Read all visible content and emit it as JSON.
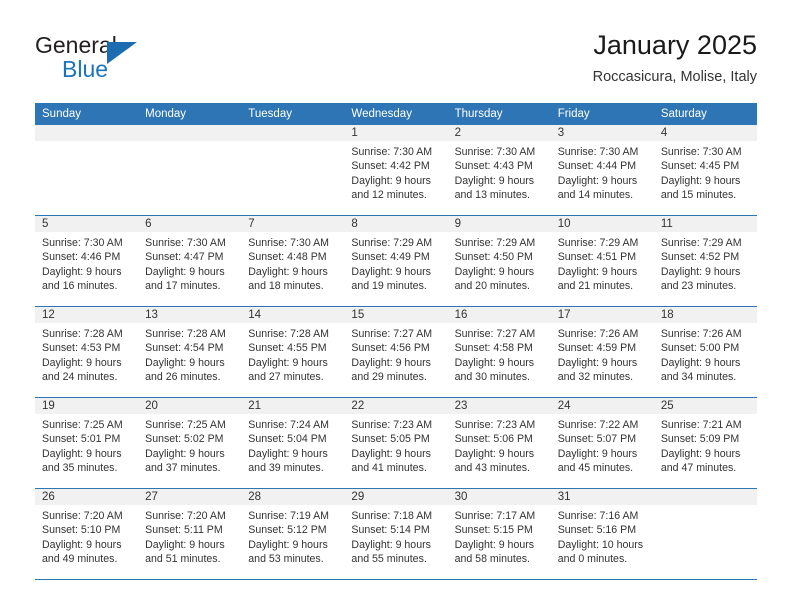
{
  "brand": {
    "name_part1": "General",
    "name_part2": "Blue",
    "logo_icon": "triangle-logo-icon"
  },
  "header": {
    "title": "January 2025",
    "subtitle": "Roccasicura, Molise, Italy"
  },
  "colors": {
    "header_blue": "#2e75b6",
    "brand_blue": "#1b75bb",
    "daynum_band": "#f1f1f1",
    "text": "#333333"
  },
  "calendar": {
    "weekday_headers": [
      "Sunday",
      "Monday",
      "Tuesday",
      "Wednesday",
      "Thursday",
      "Friday",
      "Saturday"
    ],
    "weeks": [
      [
        {
          "day": "",
          "lines": []
        },
        {
          "day": "",
          "lines": []
        },
        {
          "day": "",
          "lines": []
        },
        {
          "day": "1",
          "lines": [
            "Sunrise: 7:30 AM",
            "Sunset: 4:42 PM",
            "Daylight: 9 hours",
            "and 12 minutes."
          ]
        },
        {
          "day": "2",
          "lines": [
            "Sunrise: 7:30 AM",
            "Sunset: 4:43 PM",
            "Daylight: 9 hours",
            "and 13 minutes."
          ]
        },
        {
          "day": "3",
          "lines": [
            "Sunrise: 7:30 AM",
            "Sunset: 4:44 PM",
            "Daylight: 9 hours",
            "and 14 minutes."
          ]
        },
        {
          "day": "4",
          "lines": [
            "Sunrise: 7:30 AM",
            "Sunset: 4:45 PM",
            "Daylight: 9 hours",
            "and 15 minutes."
          ]
        }
      ],
      [
        {
          "day": "5",
          "lines": [
            "Sunrise: 7:30 AM",
            "Sunset: 4:46 PM",
            "Daylight: 9 hours",
            "and 16 minutes."
          ]
        },
        {
          "day": "6",
          "lines": [
            "Sunrise: 7:30 AM",
            "Sunset: 4:47 PM",
            "Daylight: 9 hours",
            "and 17 minutes."
          ]
        },
        {
          "day": "7",
          "lines": [
            "Sunrise: 7:30 AM",
            "Sunset: 4:48 PM",
            "Daylight: 9 hours",
            "and 18 minutes."
          ]
        },
        {
          "day": "8",
          "lines": [
            "Sunrise: 7:29 AM",
            "Sunset: 4:49 PM",
            "Daylight: 9 hours",
            "and 19 minutes."
          ]
        },
        {
          "day": "9",
          "lines": [
            "Sunrise: 7:29 AM",
            "Sunset: 4:50 PM",
            "Daylight: 9 hours",
            "and 20 minutes."
          ]
        },
        {
          "day": "10",
          "lines": [
            "Sunrise: 7:29 AM",
            "Sunset: 4:51 PM",
            "Daylight: 9 hours",
            "and 21 minutes."
          ]
        },
        {
          "day": "11",
          "lines": [
            "Sunrise: 7:29 AM",
            "Sunset: 4:52 PM",
            "Daylight: 9 hours",
            "and 23 minutes."
          ]
        }
      ],
      [
        {
          "day": "12",
          "lines": [
            "Sunrise: 7:28 AM",
            "Sunset: 4:53 PM",
            "Daylight: 9 hours",
            "and 24 minutes."
          ]
        },
        {
          "day": "13",
          "lines": [
            "Sunrise: 7:28 AM",
            "Sunset: 4:54 PM",
            "Daylight: 9 hours",
            "and 26 minutes."
          ]
        },
        {
          "day": "14",
          "lines": [
            "Sunrise: 7:28 AM",
            "Sunset: 4:55 PM",
            "Daylight: 9 hours",
            "and 27 minutes."
          ]
        },
        {
          "day": "15",
          "lines": [
            "Sunrise: 7:27 AM",
            "Sunset: 4:56 PM",
            "Daylight: 9 hours",
            "and 29 minutes."
          ]
        },
        {
          "day": "16",
          "lines": [
            "Sunrise: 7:27 AM",
            "Sunset: 4:58 PM",
            "Daylight: 9 hours",
            "and 30 minutes."
          ]
        },
        {
          "day": "17",
          "lines": [
            "Sunrise: 7:26 AM",
            "Sunset: 4:59 PM",
            "Daylight: 9 hours",
            "and 32 minutes."
          ]
        },
        {
          "day": "18",
          "lines": [
            "Sunrise: 7:26 AM",
            "Sunset: 5:00 PM",
            "Daylight: 9 hours",
            "and 34 minutes."
          ]
        }
      ],
      [
        {
          "day": "19",
          "lines": [
            "Sunrise: 7:25 AM",
            "Sunset: 5:01 PM",
            "Daylight: 9 hours",
            "and 35 minutes."
          ]
        },
        {
          "day": "20",
          "lines": [
            "Sunrise: 7:25 AM",
            "Sunset: 5:02 PM",
            "Daylight: 9 hours",
            "and 37 minutes."
          ]
        },
        {
          "day": "21",
          "lines": [
            "Sunrise: 7:24 AM",
            "Sunset: 5:04 PM",
            "Daylight: 9 hours",
            "and 39 minutes."
          ]
        },
        {
          "day": "22",
          "lines": [
            "Sunrise: 7:23 AM",
            "Sunset: 5:05 PM",
            "Daylight: 9 hours",
            "and 41 minutes."
          ]
        },
        {
          "day": "23",
          "lines": [
            "Sunrise: 7:23 AM",
            "Sunset: 5:06 PM",
            "Daylight: 9 hours",
            "and 43 minutes."
          ]
        },
        {
          "day": "24",
          "lines": [
            "Sunrise: 7:22 AM",
            "Sunset: 5:07 PM",
            "Daylight: 9 hours",
            "and 45 minutes."
          ]
        },
        {
          "day": "25",
          "lines": [
            "Sunrise: 7:21 AM",
            "Sunset: 5:09 PM",
            "Daylight: 9 hours",
            "and 47 minutes."
          ]
        }
      ],
      [
        {
          "day": "26",
          "lines": [
            "Sunrise: 7:20 AM",
            "Sunset: 5:10 PM",
            "Daylight: 9 hours",
            "and 49 minutes."
          ]
        },
        {
          "day": "27",
          "lines": [
            "Sunrise: 7:20 AM",
            "Sunset: 5:11 PM",
            "Daylight: 9 hours",
            "and 51 minutes."
          ]
        },
        {
          "day": "28",
          "lines": [
            "Sunrise: 7:19 AM",
            "Sunset: 5:12 PM",
            "Daylight: 9 hours",
            "and 53 minutes."
          ]
        },
        {
          "day": "29",
          "lines": [
            "Sunrise: 7:18 AM",
            "Sunset: 5:14 PM",
            "Daylight: 9 hours",
            "and 55 minutes."
          ]
        },
        {
          "day": "30",
          "lines": [
            "Sunrise: 7:17 AM",
            "Sunset: 5:15 PM",
            "Daylight: 9 hours",
            "and 58 minutes."
          ]
        },
        {
          "day": "31",
          "lines": [
            "Sunrise: 7:16 AM",
            "Sunset: 5:16 PM",
            "Daylight: 10 hours",
            "and 0 minutes."
          ]
        },
        {
          "day": "",
          "lines": []
        }
      ]
    ]
  }
}
